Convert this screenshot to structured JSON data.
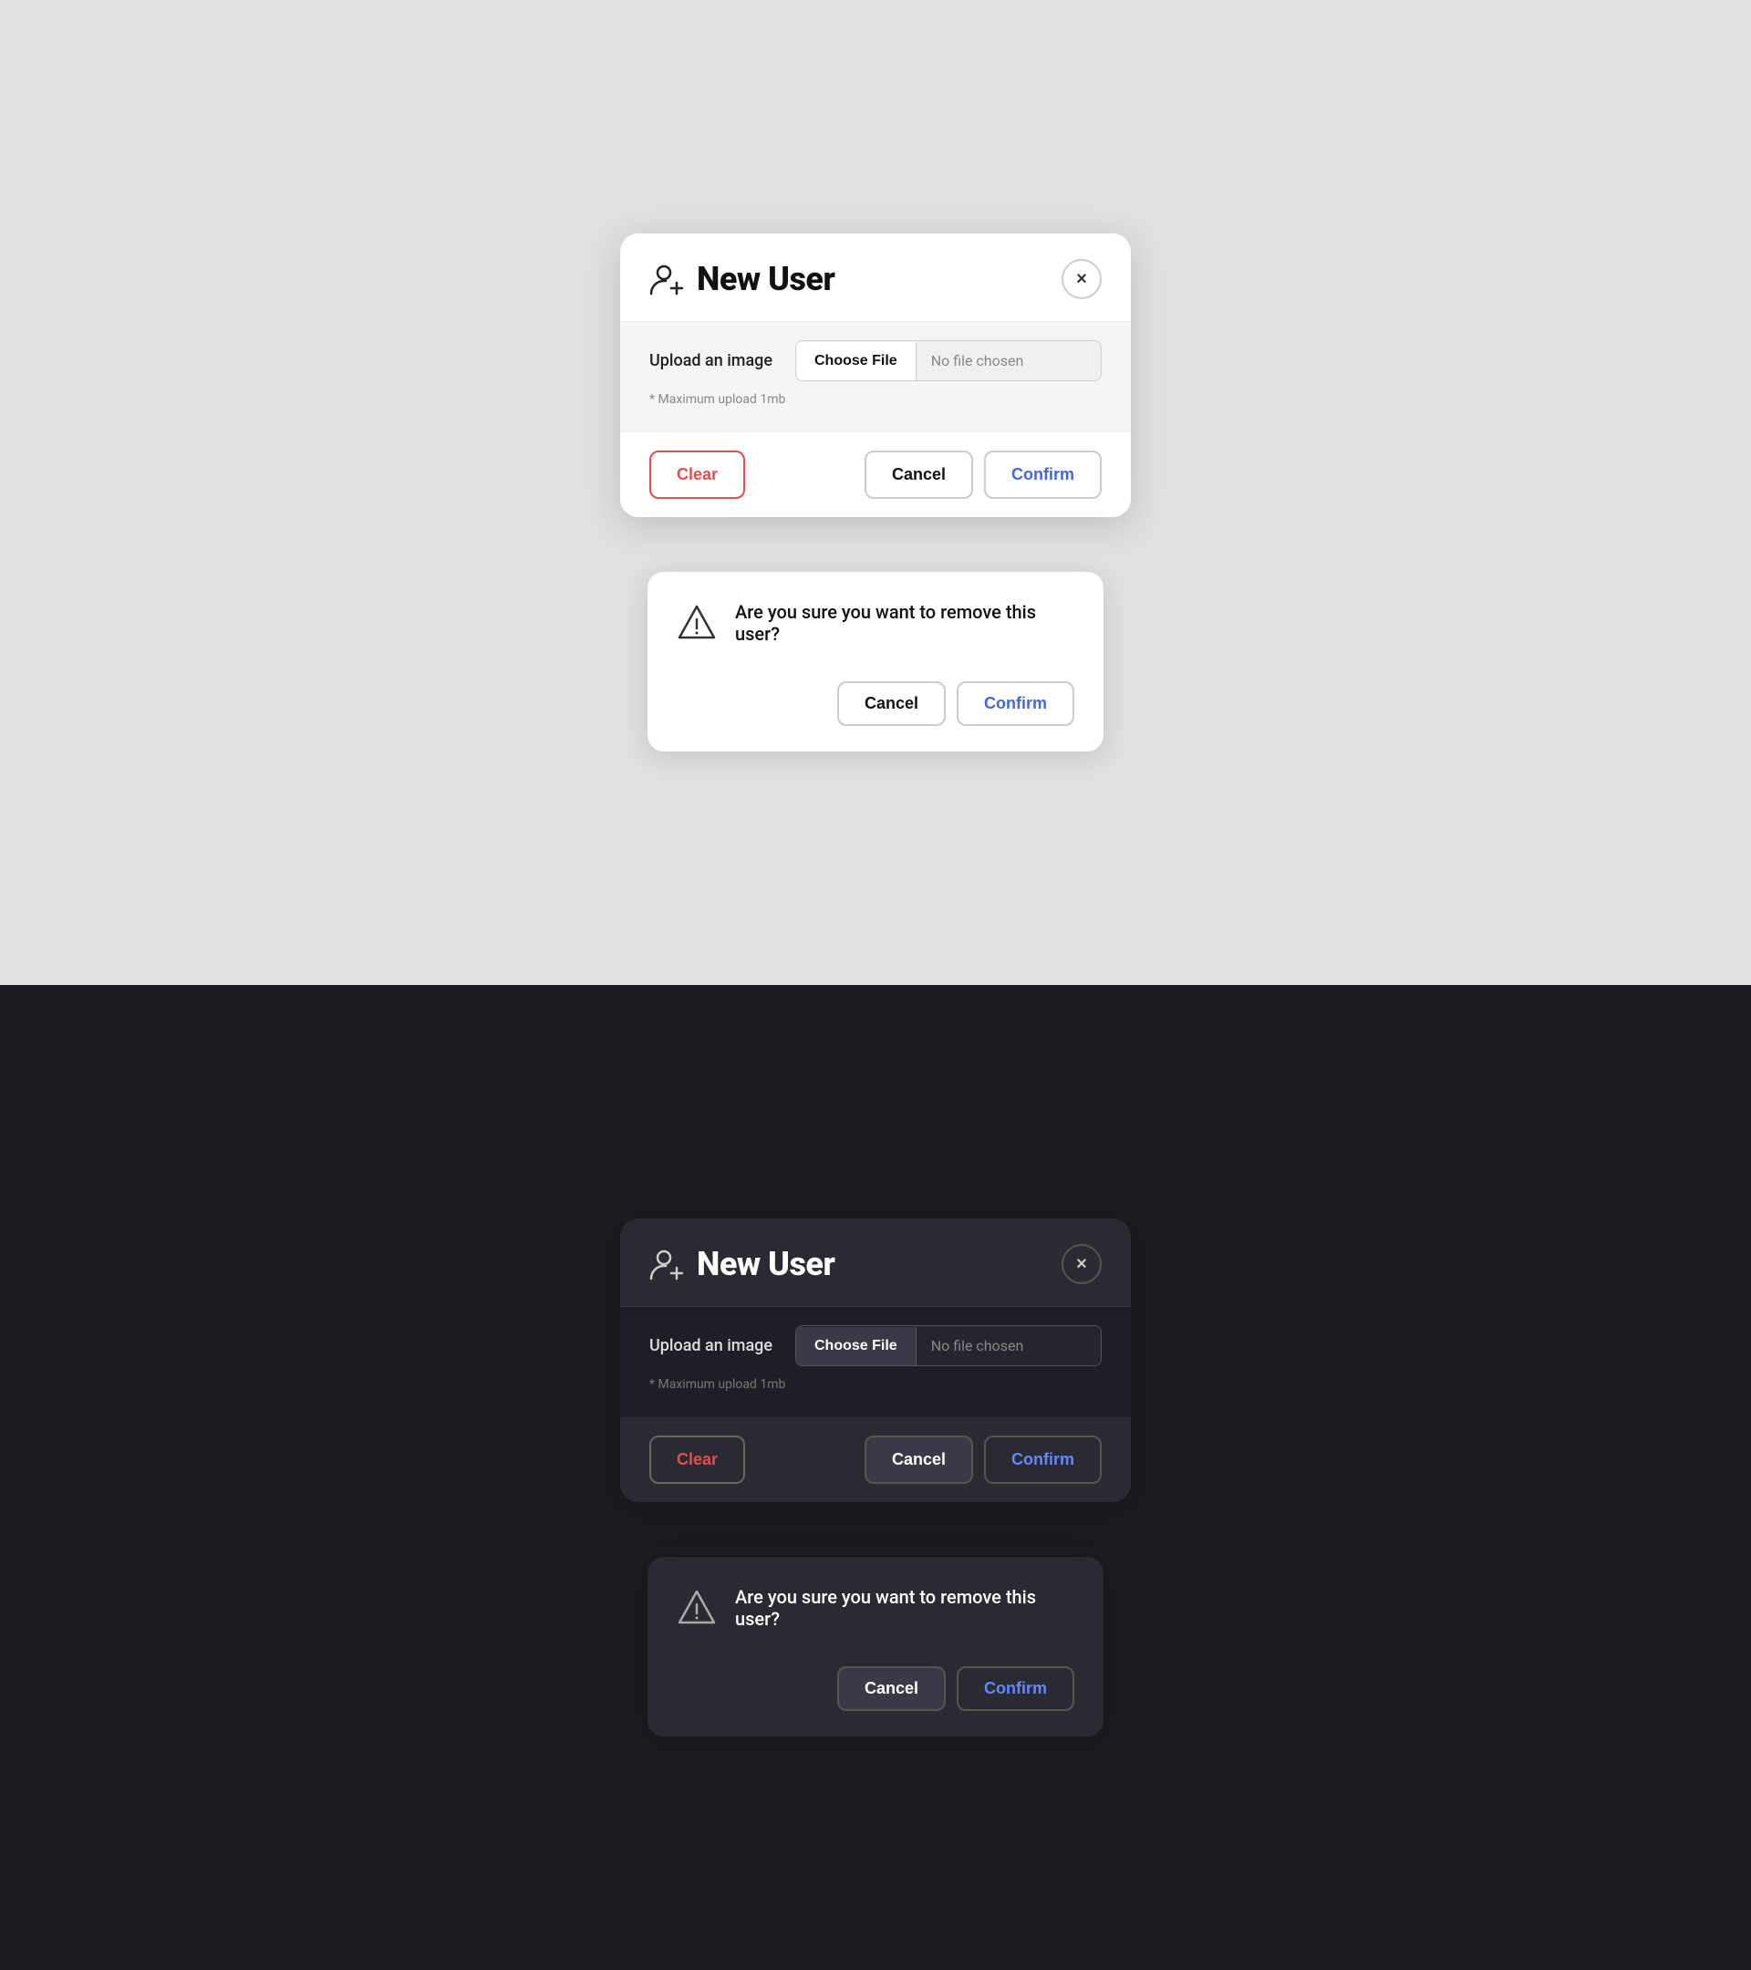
{
  "light": {
    "theme": "light",
    "modal": {
      "title": "New User",
      "close_label": "×",
      "upload_label": "Upload an image",
      "choose_file_label": "Choose File",
      "no_file_label": "No file chosen",
      "max_upload_note": "* Maximum upload 1mb",
      "clear_label": "Clear",
      "cancel_label": "Cancel",
      "confirm_label": "Confirm"
    },
    "confirm_dialog": {
      "message": "Are you sure you want to remove this user?",
      "cancel_label": "Cancel",
      "confirm_label": "Confirm"
    }
  },
  "dark": {
    "theme": "dark",
    "modal": {
      "title": "New User",
      "close_label": "×",
      "upload_label": "Upload an image",
      "choose_file_label": "Choose File",
      "no_file_label": "No file chosen",
      "max_upload_note": "* Maximum upload 1mb",
      "clear_label": "Clear",
      "cancel_label": "Cancel",
      "confirm_label": "Confirm"
    },
    "confirm_dialog": {
      "message": "Are you sure you want to remove this user?",
      "cancel_label": "Cancel",
      "confirm_label": "Confirm"
    }
  }
}
